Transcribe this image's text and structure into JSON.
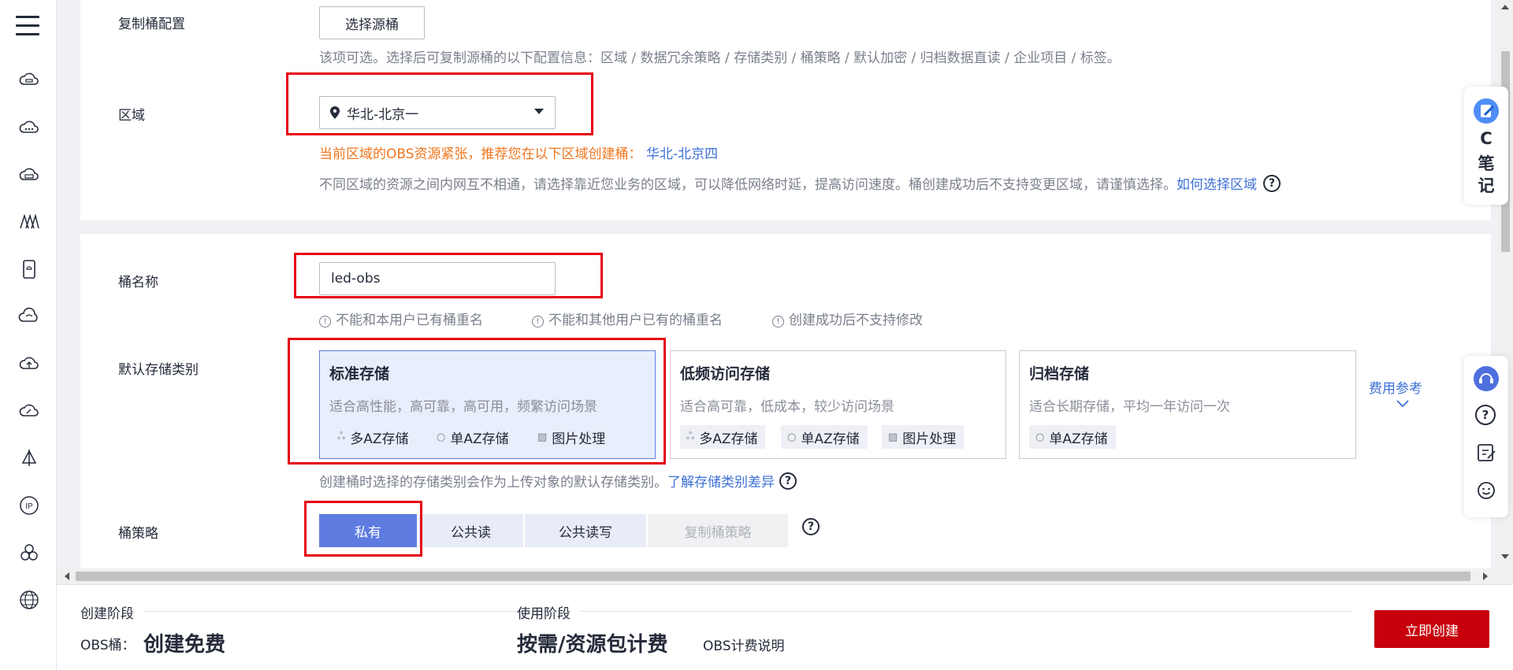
{
  "rail": {
    "icons": [
      "menu-icon",
      "cloud-server-icon",
      "cloud-dots-icon",
      "cloud-storage-icon",
      "network-icon",
      "phone-icon",
      "cloud-icon",
      "cloud-upload-icon",
      "cloud-edit-icon",
      "sail-icon",
      "ip-icon",
      "cluster-icon",
      "globe-icon"
    ]
  },
  "replicate": {
    "label": "复制桶配置",
    "button": "选择源桶",
    "hint": "该项可选。选择后可复制源桶的以下配置信息：区域 / 数据冗余策略 / 存储类别 / 桶策略 / 默认加密 / 归档数据直读 / 企业项目 / 标签。"
  },
  "region": {
    "label": "区域",
    "value": "华北-北京一",
    "warning_prefix": "当前区域的OBS资源紧张，推荐您在以下区域创建桶：",
    "warning_link": "华北-北京四",
    "hint": "不同区域的资源之间内网互不相通，请选择靠近您业务的区域，可以降低网络时延，提高访问速度。桶创建成功后不支持变更区域，请谨慎选择。",
    "hint_link": "如何选择区域"
  },
  "bucket_name": {
    "label": "桶名称",
    "value": "led-obs",
    "rules": [
      "不能和本用户已有桶重名",
      "不能和其他用户已有的桶重名",
      "创建成功后不支持修改"
    ]
  },
  "storage_class": {
    "label": "默认存储类别",
    "cards": [
      {
        "title": "标准存储",
        "desc": "适合高性能，高可靠，高可用，频繁访问场景",
        "tags": [
          "多AZ存储",
          "单AZ存储",
          "图片处理"
        ]
      },
      {
        "title": "低频访问存储",
        "desc": "适合高可靠，低成本，较少访问场景",
        "tags": [
          "多AZ存储",
          "单AZ存储",
          "图片处理"
        ]
      },
      {
        "title": "归档存储",
        "desc": "适合长期存储，平均一年访问一次",
        "tags": [
          "单AZ存储"
        ]
      }
    ],
    "fee_link": "费用参考",
    "hint": "创建桶时选择的存储类别会作为上传对象的默认存储类别。",
    "hint_link": "了解存储类别差异"
  },
  "policy": {
    "label": "桶策略",
    "options": [
      "私有",
      "公共读",
      "公共读写",
      "复制桶策略"
    ]
  },
  "note_widget": {
    "c": "C",
    "n1": "笔",
    "n2": "记"
  },
  "footer": {
    "stage1": "创建阶段",
    "obs_label": "OBS桶：",
    "obs_value": "创建免费",
    "stage2": "使用阶段",
    "billing": "按需/资源包计费",
    "billing_link": "OBS计费说明",
    "create": "立即创建"
  },
  "colors": {
    "accent": "#5e7ce0",
    "primary_red": "#c7000b",
    "warning": "#f0761d",
    "link": "#3d70d6",
    "annotation": "#e60012"
  }
}
